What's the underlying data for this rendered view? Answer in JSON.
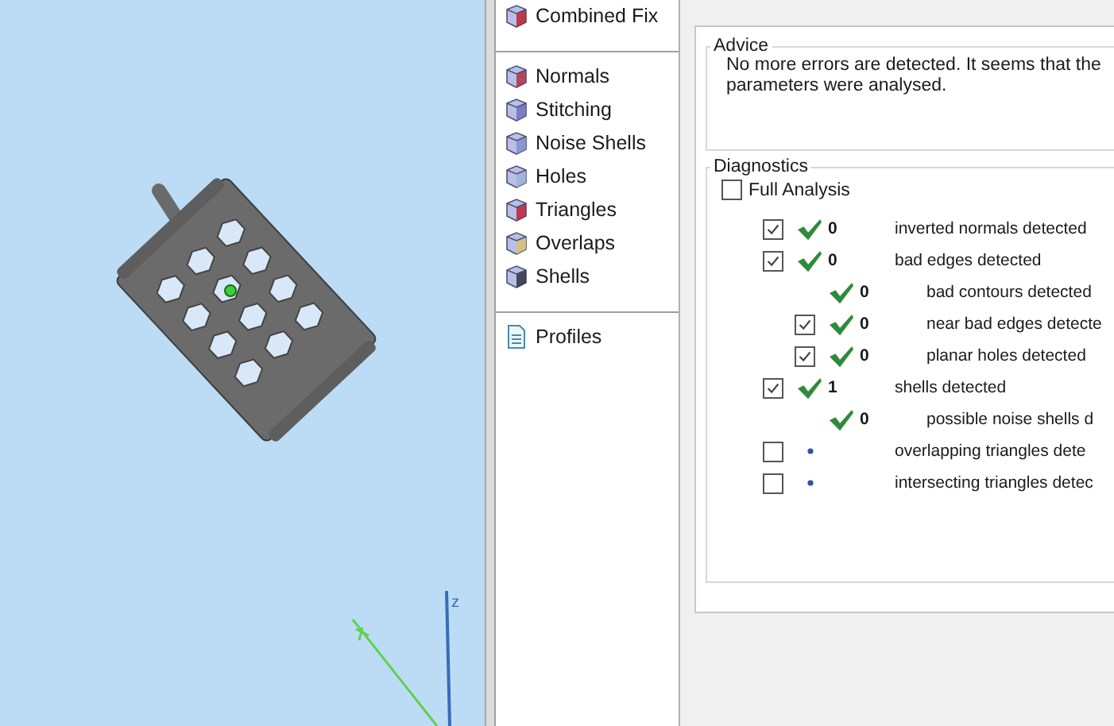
{
  "viewport": {
    "axis_label": "z"
  },
  "sidebar": {
    "groups": [
      {
        "items": [
          {
            "label": "Combined Fix",
            "kind": "tool"
          }
        ]
      },
      {
        "items": [
          {
            "label": "Normals",
            "kind": "tool"
          },
          {
            "label": "Stitching",
            "kind": "tool"
          },
          {
            "label": "Noise Shells",
            "kind": "tool"
          },
          {
            "label": "Holes",
            "kind": "tool"
          },
          {
            "label": "Triangles",
            "kind": "tool"
          },
          {
            "label": "Overlaps",
            "kind": "tool"
          },
          {
            "label": "Shells",
            "kind": "tool"
          }
        ]
      },
      {
        "items": [
          {
            "label": "Profiles",
            "kind": "document"
          }
        ]
      }
    ]
  },
  "advice": {
    "title": "Advice",
    "lines": [
      "No more errors are detected. It seems that the",
      "parameters were analysed."
    ]
  },
  "diagnostics": {
    "title": "Diagnostics",
    "full_analysis": {
      "label": "Full Analysis",
      "checked": false
    },
    "rows": [
      {
        "kind": "checkable",
        "checked": true,
        "passed": true,
        "count": "0",
        "label": "inverted normals detected"
      },
      {
        "kind": "checkable",
        "checked": true,
        "passed": true,
        "count": "0",
        "label": "bad edges detected",
        "children": [
          {
            "kind": "plain",
            "passed": true,
            "count": "0",
            "label": "bad contours detected"
          },
          {
            "kind": "checkable",
            "checked": true,
            "passed": true,
            "count": "0",
            "label": "near bad edges detecte"
          },
          {
            "kind": "checkable",
            "checked": true,
            "passed": true,
            "count": "0",
            "label": "planar holes detected"
          }
        ]
      },
      {
        "kind": "checkable",
        "checked": true,
        "passed": true,
        "count": "1",
        "label": "shells detected",
        "children": [
          {
            "kind": "plain",
            "passed": true,
            "count": "0",
            "label": "possible noise shells d"
          }
        ]
      },
      {
        "kind": "checkable",
        "checked": false,
        "passed": false,
        "label": "overlapping triangles dete"
      },
      {
        "kind": "checkable",
        "checked": false,
        "passed": false,
        "label": "intersecting triangles detec"
      }
    ]
  }
}
